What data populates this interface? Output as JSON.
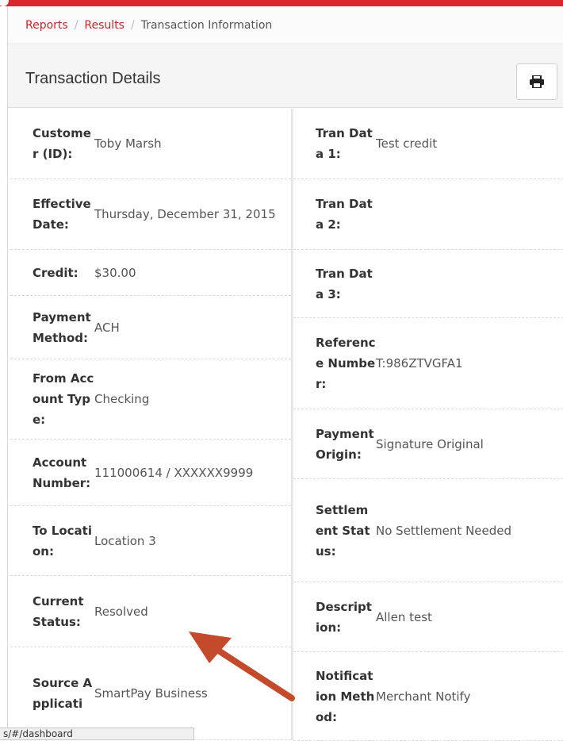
{
  "breadcrumb": {
    "reports": "Reports",
    "results": "Results",
    "current": "Transaction Information"
  },
  "panel": {
    "title": "Transaction Details",
    "print_icon": "print-icon"
  },
  "left": [
    {
      "label": "Customer (ID):",
      "value": "Toby Marsh"
    },
    {
      "label": "Effective Date:",
      "value": "Thursday, December 31, 2015"
    },
    {
      "label": "Credit:",
      "value": "$30.00"
    },
    {
      "label": "Payment Method:",
      "value": "ACH"
    },
    {
      "label": "From Account Type:",
      "value": "Checking"
    },
    {
      "label": "Account Number:",
      "value": "111000614 / XXXXXX9999"
    },
    {
      "label": "To Location:",
      "value": "Location 3"
    },
    {
      "label": "Current Status:",
      "value": "Resolved"
    },
    {
      "label": "Source Applicati",
      "value": "SmartPay Business"
    }
  ],
  "right": [
    {
      "label": "Tran Data 1:",
      "value": "Test credit"
    },
    {
      "label": "Tran Data 2:",
      "value": ""
    },
    {
      "label": "Tran Data 3:",
      "value": ""
    },
    {
      "label": "Reference Number:",
      "value": "T:986ZTVGFA1"
    },
    {
      "label": "Payment Origin:",
      "value": "Signature Original"
    },
    {
      "label": "Settlement Status:",
      "value": "No Settlement Needed"
    },
    {
      "label": "Description:",
      "value": "Allen test"
    },
    {
      "label": "Notification Method:",
      "value": "Merchant Notify"
    }
  ],
  "statusbar": {
    "url": "s/#/dashboard"
  },
  "colors": {
    "accent": "#c0282d",
    "topbar": "#d9252b",
    "arrow": "#c44a2c"
  }
}
